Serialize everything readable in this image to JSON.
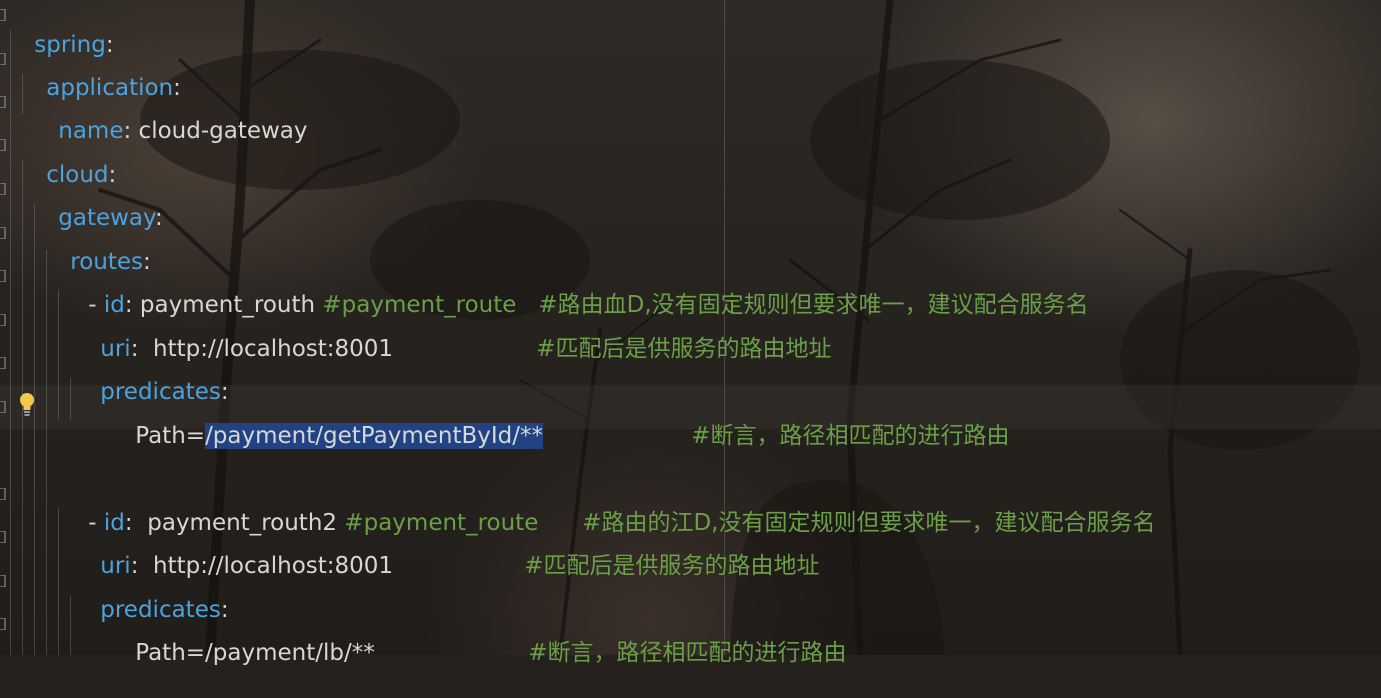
{
  "editor": {
    "lines": {
      "l1": {
        "key": "spring",
        "colon": ":"
      },
      "l2": {
        "key": "application",
        "colon": ":"
      },
      "l3": {
        "key": "name",
        "colon": ":",
        "value": " cloud-gateway"
      },
      "l4": {
        "key": "cloud",
        "colon": ":"
      },
      "l5": {
        "key": "gateway",
        "colon": ":"
      },
      "l6": {
        "key": "routes",
        "colon": ":"
      },
      "l7": {
        "dash": "- ",
        "key": "id",
        "colon": ":",
        "value": " payment_routh ",
        "comment": "#payment_route   #路由血D,没有固定规则但要求唯一，建议配合服务名"
      },
      "l8": {
        "key": "uri",
        "colon": ":",
        "value": "  http://localhost:8001",
        "comment": "#匹配后是供服务的路由地址"
      },
      "l9": {
        "key": "predicates",
        "colon": ":"
      },
      "l10": {
        "prefix": "Path=",
        "selected": "/payment/getPaymentById/**",
        "comment": "#断言，路径相匹配的进行路由"
      },
      "l12": {
        "dash": "- ",
        "key": "id",
        "colon": ":",
        "value": "  payment_routh2 ",
        "comment": "#payment_route      #路由的江D,没有固定规则但要求唯一，建议配合服务名"
      },
      "l13": {
        "key": "uri",
        "colon": ":",
        "value": "  http://localhost:8001",
        "comment": "#匹配后是供服务的路由地址"
      },
      "l14": {
        "key": "predicates",
        "colon": ":"
      },
      "l15": {
        "prefix": "Path=/payment/lb/**",
        "comment": "#断言，路径相匹配的进行路由"
      }
    }
  },
  "colors": {
    "key": "#4aa3df",
    "comment": "#6a9f48",
    "selection": "#214283"
  },
  "icons": {
    "intention_bulb": "lightbulb-icon"
  }
}
